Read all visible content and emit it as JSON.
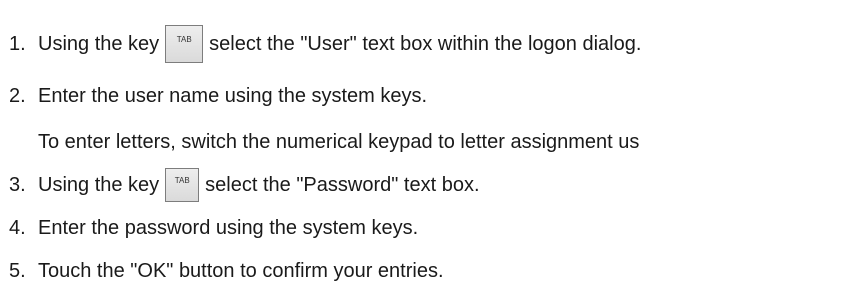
{
  "steps": [
    {
      "number": "1.",
      "before": "Using the key",
      "key_label": "TAB",
      "after": "select the \"User\" text box within the logon dialog."
    },
    {
      "number": "2.",
      "text": "Enter the user name using the system keys."
    },
    {
      "note": "To enter letters, switch the numerical keypad to letter assignment us"
    },
    {
      "number": "3.",
      "before": "Using the key",
      "key_label": "TAB",
      "after": "select the \"Password\" text box."
    },
    {
      "number": "4.",
      "text": "Enter the password using the system keys."
    },
    {
      "number": "5.",
      "text": "Touch the \"OK\" button to confirm your entries."
    }
  ]
}
